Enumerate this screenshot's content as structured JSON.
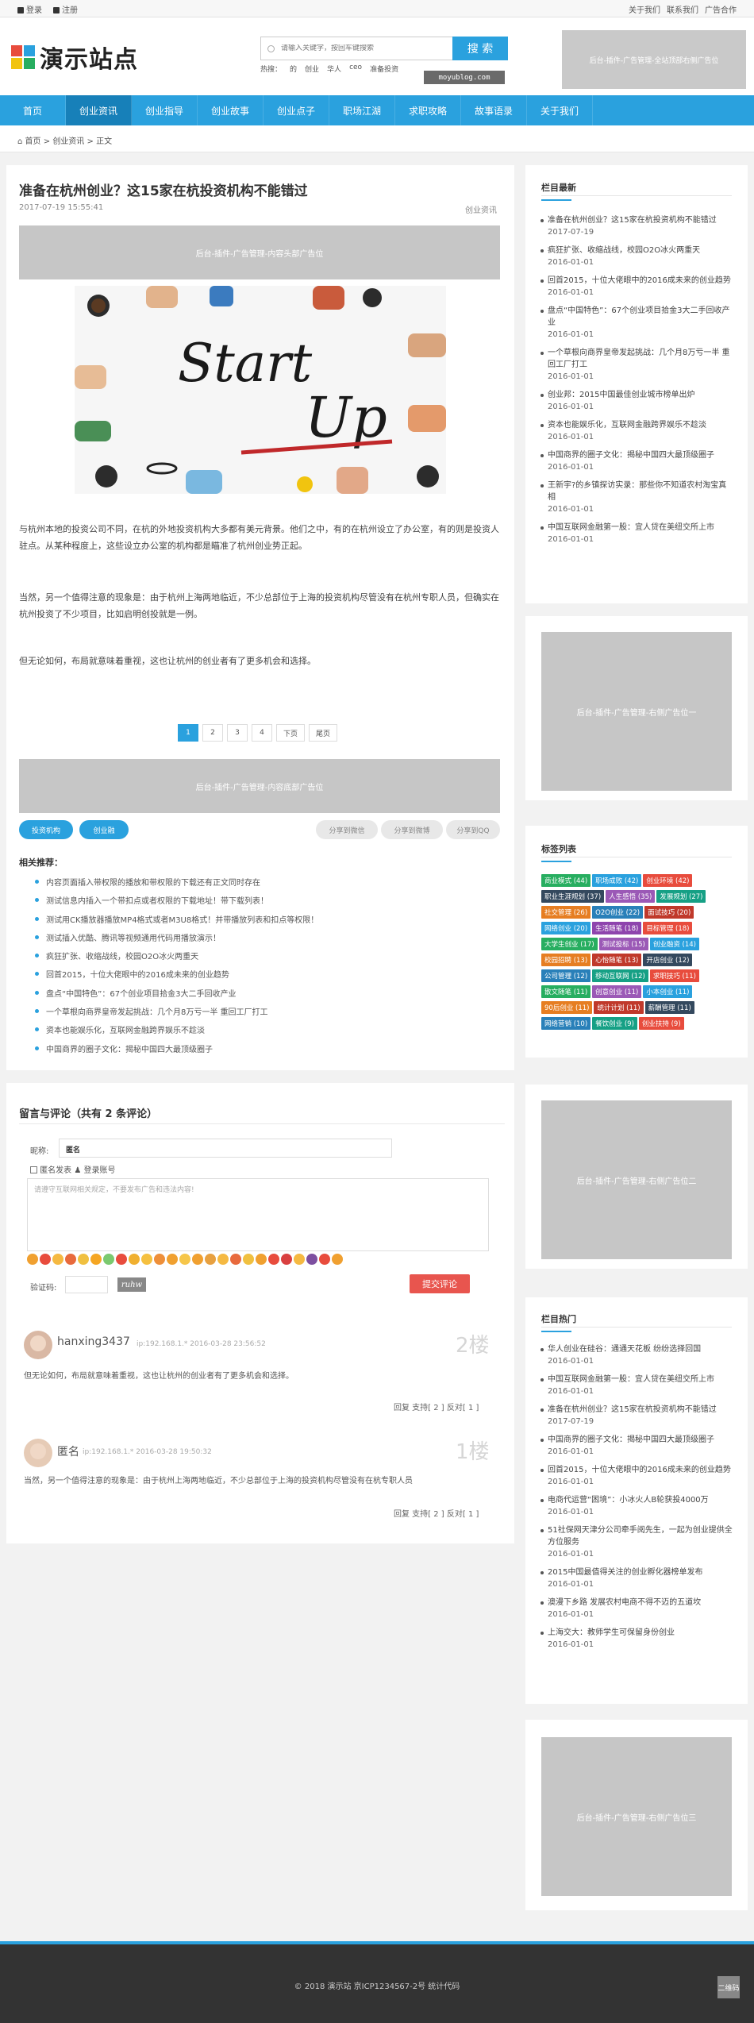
{
  "topbar": {
    "login": "登录",
    "register": "注册",
    "about": "关于我们",
    "contact": "联系我们",
    "ads": "广告合作"
  },
  "header": {
    "logo_text": "演示站点",
    "logo_colors": [
      "#e84c3d",
      "#2aa1de",
      "#f1c40f",
      "#27ae60"
    ],
    "search_placeholder": "请输入关键字，按回车键搜索",
    "search_button": "搜 索",
    "hot_label": "热搜：",
    "hot_words": [
      "的",
      "创业",
      "华人",
      "ceo",
      "准备投资"
    ],
    "site_tag": "moyublog.com",
    "ad_top": "后台-插件-广告管理-全站顶部右侧广告位"
  },
  "nav": [
    "首页",
    "创业资讯",
    "创业指导",
    "创业故事",
    "创业点子",
    "职场江湖",
    "求职攻略",
    "故事语录",
    "关于我们"
  ],
  "nav_active": 1,
  "breadcrumb": {
    "home": "首页",
    "sep": ">",
    "cat": "创业资讯",
    "current": "正文"
  },
  "article": {
    "title": "准备在杭州创业？这15家在杭投资机构不能错过",
    "date": "2017-07-19 15:55:41",
    "category": "创业资讯",
    "ad_head": "后台-插件-广告管理-内容头部广告位",
    "image_alt": "Start Up",
    "paragraphs": [
      "与杭州本地的投资公司不同，在杭的外地投资机构大多都有美元背景。他们之中，有的在杭州设立了办公室，有的则是投资人驻点。从某种程度上，这些设立办公室的机构都是瞄准了杭州创业势正起。",
      "当然，另一个值得注意的现象是：由于杭州上海两地临近，不少总部位于上海的投资机构尽管没有在杭州专职人员，但确实在杭州投资了不少项目，比如启明创投就是一例。",
      "但无论如何，布局就意味着重视，这也让杭州的创业者有了更多机会和选择。"
    ],
    "pager": [
      "1",
      "2",
      "3",
      "4",
      "下页",
      "尾页"
    ],
    "ad_bottom": "后台-插件-广告管理-内容底部广告位",
    "tags": [
      "投资机构",
      "创业融"
    ],
    "share": [
      "分享到微信",
      "分享到微博",
      "分享到QQ"
    ],
    "related_title": "相关推荐：",
    "related": [
      "内容页面插入带权限的播放和带权限的下载还有正文同时存在",
      "测试信息内插入一个带扣点或者权限的下载地址！带下载列表！",
      "测试用CK播放器播放MP4格式或者M3U8格式！并带播放列表和扣点等权限！",
      "测试插入优酷、腾讯等视频通用代码用播放演示！",
      "疯狂扩张、收缩战线，校园O2O冰火两重天",
      "回首2015，十位大佬眼中的2016成未来的创业趋势",
      "盘点“中国特色”：67个创业项目拾金3大二手回收产业",
      "一个草根向商界皇帝发起挑战：几个月8万亏一半 重回工厂打工",
      "资本也能娱乐化，互联网金融跨界娱乐不趁淡",
      "中国商界的圈子文化：揭秘中国四大最顶级圈子"
    ]
  },
  "comments": {
    "title": "留言与评论（共有 2 条评论）",
    "nick_label": "昵称:",
    "nick_value": "匿名",
    "anon_label": "匿名发表",
    "login_label": "登录账号",
    "textarea_placeholder": "请遵守互联网相关规定，不要发布广告和违法内容!",
    "emoji_colors": [
      "#f0a030",
      "#e84c3d",
      "#f5b942",
      "#e86a3d",
      "#f0c040",
      "#f5a623",
      "#7bc96f",
      "#e84c3d",
      "#f0b030",
      "#f5c040",
      "#ee8f3a",
      "#f0a030",
      "#f6c64a",
      "#f0a030",
      "#e7a040",
      "#f5b942",
      "#e86a3d",
      "#f0c040",
      "#f0a030",
      "#e84c3d",
      "#d94040",
      "#f5b942",
      "#7d4fa0",
      "#e84c3d",
      "#f0a030"
    ],
    "captcha_label": "验证码:",
    "captcha_text": "ruhw",
    "submit": "提交评论",
    "items": [
      {
        "name": "hanxing3437",
        "meta": "ip:192.168.1.* 2016-03-28 23:56:52",
        "floor": "2楼",
        "text": "但无论如何，布局就意味着重视，这也让杭州的创业者有了更多机会和选择。",
        "actions": "回复  支持[ 2 ]  反对[ 1 ]"
      },
      {
        "name": "匿名",
        "meta": "ip:192.168.1.* 2016-03-28 19:50:32",
        "floor": "1楼",
        "text": "当然，另一个值得注意的现象是：由于杭州上海两地临近，不少总部位于上海的投资机构尽管没有在杭专职人员",
        "actions": "回复  支持[ 2 ]  反对[ 1 ]"
      }
    ]
  },
  "sidebar": {
    "latest_title": "栏目最新",
    "latest": [
      {
        "t": "准备在杭州创业？这15家在杭投资机构不能错过",
        "d": "2017-07-19"
      },
      {
        "t": "疯狂扩张、收缩战线，校园O2O冰火两重天",
        "d": "2016-01-01"
      },
      {
        "t": "回首2015，十位大佬眼中的2016成未来的创业趋势",
        "d": "2016-01-01"
      },
      {
        "t": "盘点“中国特色”：67个创业项目拾金3大二手回收产业",
        "d": "2016-01-01"
      },
      {
        "t": "一个草根向商界皇帝发起挑战：几个月8万亏一半 重回工厂打工",
        "d": "2016-01-01"
      },
      {
        "t": "创业邦：2015中国最佳创业城市榜单出炉",
        "d": "2016-01-01"
      },
      {
        "t": "资本也能娱乐化，互联网金融跨界娱乐不趁淡",
        "d": "2016-01-01"
      },
      {
        "t": "中国商界的圈子文化：揭秘中国四大最顶级圈子",
        "d": "2016-01-01"
      },
      {
        "t": "王新宇?的乡镇探访实录：那些你不知道农村淘宝真相",
        "d": "2016-01-01"
      },
      {
        "t": "中国互联网金融第一股：宜人贷在美纽交所上市",
        "d": "2016-01-01"
      }
    ],
    "ad1": "后台-插件-广告管理-右侧广告位一",
    "tags_title": "标签列表",
    "tags": [
      {
        "t": "商业模式 (44)",
        "c": "#27ae60"
      },
      {
        "t": "职场成败 (42)",
        "c": "#2aa1de"
      },
      {
        "t": "创业环境 (42)",
        "c": "#e84c3d"
      },
      {
        "t": "职业生涯规划 (37)",
        "c": "#34495e"
      },
      {
        "t": "人生感悟 (35)",
        "c": "#9b59b6"
      },
      {
        "t": "发展规划 (27)",
        "c": "#16a085"
      },
      {
        "t": "社交管理 (26)",
        "c": "#e67e22"
      },
      {
        "t": "O2O创业 (22)",
        "c": "#2980b9"
      },
      {
        "t": "面试技巧 (20)",
        "c": "#c0392b"
      },
      {
        "t": "网络创业 (20)",
        "c": "#2aa1de"
      },
      {
        "t": "生活随笔 (18)",
        "c": "#8e44ad"
      },
      {
        "t": "目标管理 (18)",
        "c": "#e84c3d"
      },
      {
        "t": "大学生创业 (17)",
        "c": "#27ae60"
      },
      {
        "t": "测试投标 (15)",
        "c": "#9b59b6"
      },
      {
        "t": "创业融资 (14)",
        "c": "#2aa1de"
      },
      {
        "t": "校园招聘 (13)",
        "c": "#e67e22"
      },
      {
        "t": "心怡随笔 (13)",
        "c": "#c0392b"
      },
      {
        "t": "开店创业 (12)",
        "c": "#34495e"
      },
      {
        "t": "公司管理 (12)",
        "c": "#2980b9"
      },
      {
        "t": "移动互联网 (12)",
        "c": "#16a085"
      },
      {
        "t": "求职技巧 (11)",
        "c": "#e84c3d"
      },
      {
        "t": "散文随笔 (11)",
        "c": "#27ae60"
      },
      {
        "t": "创意创业 (11)",
        "c": "#9b59b6"
      },
      {
        "t": "小本创业 (11)",
        "c": "#2aa1de"
      },
      {
        "t": "90后创业 (11)",
        "c": "#e67e22"
      },
      {
        "t": "统计计划 (11)",
        "c": "#c0392b"
      },
      {
        "t": "薪酬管理 (11)",
        "c": "#34495e"
      },
      {
        "t": "网络营销 (10)",
        "c": "#2980b9"
      },
      {
        "t": "餐饮创业 (9)",
        "c": "#16a085"
      },
      {
        "t": "创业扶持 (9)",
        "c": "#e84c3d"
      }
    ],
    "ad2": "后台-插件-广告管理-右侧广告位二",
    "hot_title": "栏目热门",
    "hot": [
      {
        "t": "华人创业在硅谷：通通天花板 纷纷选择回国",
        "d": "2016-01-01"
      },
      {
        "t": "中国互联网金融第一股：宜人贷在美纽交所上市",
        "d": "2016-01-01"
      },
      {
        "t": "准备在杭州创业？这15家在杭投资机构不能错过",
        "d": "2017-07-19"
      },
      {
        "t": "中国商界的圈子文化：揭秘中国四大最顶级圈子",
        "d": "2016-01-01"
      },
      {
        "t": "回首2015，十位大佬眼中的2016成未来的创业趋势",
        "d": "2016-01-01"
      },
      {
        "t": "电商代运营“困境”：小冰火人B轮获投4000万",
        "d": "2016-01-01"
      },
      {
        "t": "51社保网天津分公司牵手阅先生，一起为创业提供全方位服务",
        "d": "2016-01-01"
      },
      {
        "t": "2015中国最值得关注的创业孵化器榜单发布",
        "d": "2016-01-01"
      },
      {
        "t": "澳漫下乡路 发展农村电商不得不迈的五道坎",
        "d": "2016-01-01"
      },
      {
        "t": "上海交大：教师学生可保留身份创业",
        "d": "2016-01-01"
      }
    ],
    "ad3": "后台-插件-广告管理-右侧广告位三"
  },
  "footer": {
    "copyright": "© 2018 演示站  京ICP1234567-2号  统计代码",
    "qr": "二维码"
  }
}
